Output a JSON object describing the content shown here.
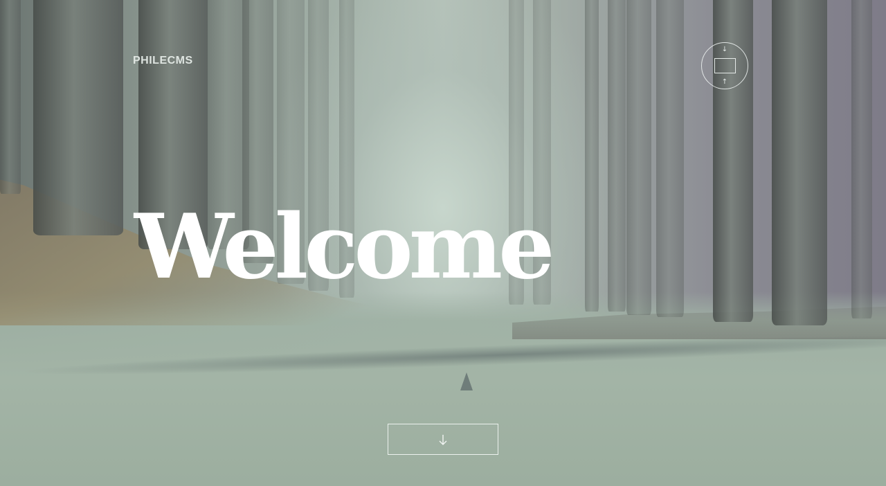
{
  "brand": {
    "name": "PHILECMS"
  },
  "hero": {
    "headline": "Welcome"
  },
  "menu_toggle": {
    "icon": "menu-toggle-icon"
  },
  "scroll_button": {
    "icon": "arrow-down-icon"
  },
  "colors": {
    "text": "#ffffff",
    "brand_text": "#e8eeea",
    "outline": "#f0f4f2",
    "background_mid": "#a5b3aa"
  }
}
